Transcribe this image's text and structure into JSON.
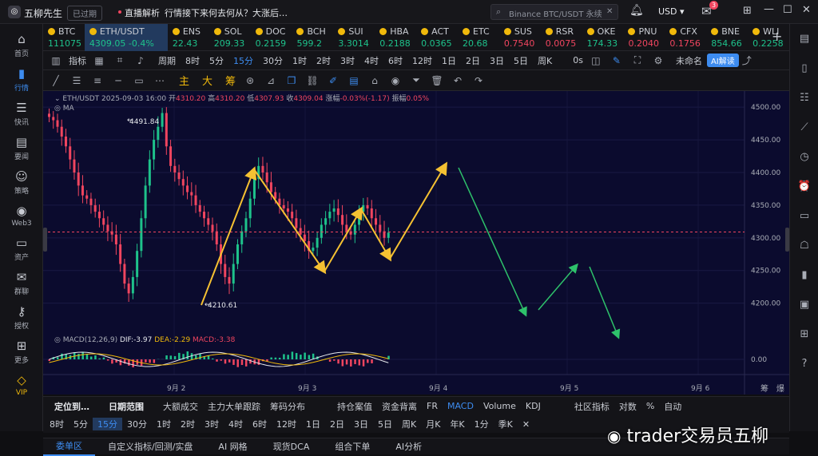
{
  "app": {
    "title": "五柳先生",
    "status": "已过期",
    "live_label": "直播解析",
    "live_text": "行情接下来何去何从？大涨后…",
    "search_placeholder": "Binance BTC/USDT 永续",
    "currency": "USD",
    "mail_badge": "3"
  },
  "leftnav": [
    {
      "label": "首页",
      "icon": "home-icon"
    },
    {
      "label": "行情",
      "icon": "bar-chart-icon",
      "active": true
    },
    {
      "label": "快讯",
      "icon": "news-icon"
    },
    {
      "label": "要闻",
      "icon": "doc-icon"
    },
    {
      "label": "策略",
      "icon": "robot-icon"
    },
    {
      "label": "Web3",
      "icon": "globe-icon"
    },
    {
      "label": "资产",
      "icon": "wallet-icon"
    },
    {
      "label": "群聊",
      "icon": "chat-icon"
    },
    {
      "label": "授权",
      "icon": "key-icon"
    },
    {
      "label": "更多",
      "icon": "grid-icon"
    },
    {
      "label": "VIP",
      "icon": "diamond-icon"
    }
  ],
  "tickers": [
    {
      "name": "BTC",
      "price": "111075",
      "dir": "up"
    },
    {
      "name": "ETH/USDT",
      "price": "4309.05",
      "change": "-0.4%",
      "dir": "up",
      "selected": true
    },
    {
      "name": "ENS",
      "price": "22.43",
      "dir": "up"
    },
    {
      "name": "SOL",
      "price": "209.33",
      "dir": "up"
    },
    {
      "name": "DOC",
      "price": "0.2159",
      "dir": "up"
    },
    {
      "name": "BCH",
      "price": "599.2",
      "dir": "up"
    },
    {
      "name": "SUI",
      "price": "3.3014",
      "dir": "up"
    },
    {
      "name": "HBA",
      "price": "0.2188",
      "dir": "up"
    },
    {
      "name": "ACT",
      "price": "0.0365",
      "dir": "up"
    },
    {
      "name": "ETC",
      "price": "20.68",
      "dir": "up"
    },
    {
      "name": "SUS",
      "price": "0.7540",
      "dir": "dn"
    },
    {
      "name": "RSR",
      "price": "0.0075",
      "dir": "dn"
    },
    {
      "name": "OKE",
      "price": "174.33",
      "dir": "up"
    },
    {
      "name": "PNU",
      "price": "0.2040",
      "dir": "dn"
    },
    {
      "name": "CFX",
      "price": "0.1756",
      "dir": "dn"
    },
    {
      "name": "BNE",
      "price": "854.66",
      "dir": "up"
    },
    {
      "name": "WLI",
      "price": "0.2258",
      "dir": "up"
    }
  ],
  "toolbar": {
    "indicator": "指标",
    "period": "周期",
    "intervals": [
      "8时",
      "5分",
      "15分",
      "30分",
      "1时",
      "2时",
      "3时",
      "4时",
      "6时",
      "12时",
      "1日",
      "2日",
      "3日",
      "5日",
      "周K"
    ],
    "active_interval": "15分",
    "right_label": "0s",
    "unnamed": "未命名",
    "ai": "AI解读"
  },
  "drawtools": {
    "labels": [
      "主",
      "大",
      "筹"
    ]
  },
  "chart": {
    "symbol": "ETH/USDT",
    "date": "2025-09-03 16:00",
    "open_label": "开",
    "open": "4310.20",
    "high_label": "高",
    "high": "4310.20",
    "low_label": "低",
    "low": "4307.93",
    "close_label": "收",
    "close": "4309.04",
    "chg_label": "涨幅",
    "chg": "-0.03%(-1.17)",
    "amp_label": "振幅",
    "amp": "0.05%",
    "ma": "MA",
    "high_mark": "4491.84",
    "low_mark": "4210.61",
    "macd_label": "MACD(12,26,9)",
    "dif": "DIF:-3.97",
    "dea": "DEA:-2.29",
    "macd": "MACD:-3.38",
    "y_ticks": [
      "4500.00",
      "4450.00",
      "4400.00",
      "4350.00",
      "4300.00",
      "4250.00",
      "4200.00"
    ],
    "macd_tick": "0.00",
    "x_ticks": [
      "9月 2",
      "9月 3",
      "9月 4",
      "9月 5",
      "9月 6"
    ],
    "axis_corner": [
      "筹",
      "爆"
    ]
  },
  "chart_data": {
    "type": "candlestick",
    "series_close": [
      4485,
      4480,
      4470,
      4455,
      4440,
      4420,
      4400,
      4380,
      4365,
      4360,
      4350,
      4340,
      4330,
      4320,
      4310,
      4305,
      4290,
      4260,
      4230,
      4215,
      4240,
      4280,
      4330,
      4380,
      4420,
      4450,
      4470,
      4491,
      4440,
      4410,
      4400,
      4390,
      4380,
      4370,
      4365,
      4350,
      4340,
      4330,
      4320,
      4310,
      4290,
      4260,
      4240,
      4230,
      4260,
      4290,
      4310,
      4330,
      4360,
      4390,
      4410,
      4400,
      4385,
      4370,
      4360,
      4350,
      4345,
      4340,
      4330,
      4315,
      4305,
      4295,
      4280,
      4285,
      4300,
      4320,
      4330,
      4340,
      4345,
      4335,
      4320,
      4310,
      4305,
      4320,
      4340,
      4350,
      4345,
      4330,
      4320,
      4310,
      4300,
      4308
    ]
  },
  "bottom": {
    "tabs": [
      "定位到…",
      "日期范围",
      "大额成交",
      "主力大单跟踪",
      "筹码分布",
      "持仓案值",
      "资金背离",
      "FR",
      "MACD",
      "Volume",
      "KDJ",
      "社区指标",
      "对数",
      "%",
      "自动"
    ],
    "active": "MACD",
    "intervals": [
      "8时",
      "5分",
      "15分",
      "30分",
      "1时",
      "2时",
      "3时",
      "4时",
      "6时",
      "12时",
      "1日",
      "2日",
      "3日",
      "5日",
      "周K",
      "月K",
      "年K",
      "1分",
      "季K"
    ],
    "active_interval": "15分",
    "footer": [
      "委单区",
      "自定义指标/回测/实盘",
      "AI 网格",
      "现货DCA",
      "组合下单",
      "AI分析"
    ],
    "watermark": "trader交易员五柳"
  }
}
